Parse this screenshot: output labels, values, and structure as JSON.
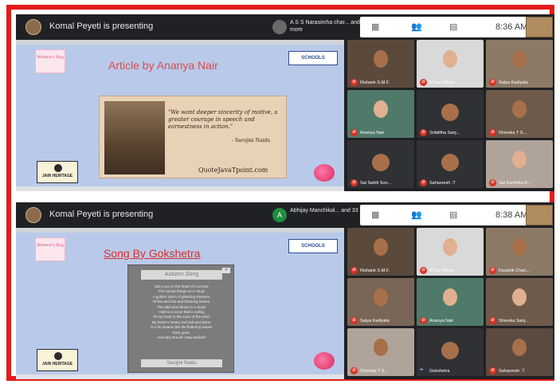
{
  "colors": {
    "frame": "#e41b1b",
    "meet_bg": "#202124",
    "slide_bg": "#b9c9ea",
    "mic_muted": "#d93025"
  },
  "top": {
    "presenter": "Komal Peyeti is presenting",
    "chat_preview": "A S S Narasimha char... and 30 more",
    "time": "8:36 AM",
    "slide": {
      "title": "Article by Ananya Nair",
      "womens_day_badge": "Women's Day",
      "school_logo": "SCHOOLS",
      "heritage_logo": "JAIN HERITAGE",
      "quote": "\"We want deeper sincerity of motive, a greater courage in speech and earnestness in action.\"",
      "quote_author": "- Sarojini Naidu",
      "quote_site": "QuoteJavaTpoint.com"
    },
    "participants": [
      {
        "name": "Rishank S.M.F.",
        "tone": "#5b4a3c",
        "face": "dark"
      },
      {
        "name": "M.Sai Nithya",
        "tone": "#d9d9d9",
        "face": "light"
      },
      {
        "name": "Satya Kadiyala",
        "tone": "#8c7a66",
        "face": "dark"
      },
      {
        "name": "Ananya Nair",
        "tone": "#4f7a6a",
        "face": "light"
      },
      {
        "name": "Srilalitha Sanj...",
        "tone": "#303134",
        "face": "round"
      },
      {
        "name": "Shreeka T S...",
        "tone": "#6e5a4a",
        "face": "dark"
      },
      {
        "name": "Sai Sahiti Son...",
        "tone": "#303134",
        "face": "round"
      },
      {
        "name": "Sahasresh .T",
        "tone": "#303134",
        "face": "round"
      },
      {
        "name": "Sai Kanthika K...",
        "tone": "#b0a49a",
        "face": "light"
      }
    ]
  },
  "bottom": {
    "presenter": "Komal Peyeti is presenting",
    "chat_initial": "A",
    "chat_preview": "Abhijay Manchikal... and 33 more",
    "time": "8:38 AM",
    "slide": {
      "title": "Song By  Gokshetra",
      "womens_day_badge": "Women's Day",
      "school_logo": "SCHOOLS",
      "heritage_logo": "JAIN HERITAGE",
      "song_heading": "Autumn Song",
      "song_close": "✕",
      "song_lines": [
        "Like a joy on the heart of a sorrow,",
        "The sunset hangs on a cloud;",
        "A golden storm of glittering sheaves,",
        "Of fair and frail and fluttering leaves,",
        "The wild wind blows in a cloud.",
        "Hark to a voice that is calling",
        "To my heart in the voice of the wind:",
        "My heart is weary and sad and alone,",
        "For its dreams like the fluttering leaves",
        "have gone,",
        "And why should I stay behind?"
      ],
      "song_author": "Sarojini Naidu"
    },
    "participants": [
      {
        "name": "Rishank S.M.F.",
        "tone": "#5b4a3c",
        "face": "dark"
      },
      {
        "name": "M.Sai Nithya",
        "tone": "#d9d9d9",
        "face": "light"
      },
      {
        "name": "Kaushik Chari...",
        "tone": "#8c7a66",
        "face": "dark"
      },
      {
        "name": "Satya Kadiyala",
        "tone": "#7a6656",
        "face": "dark"
      },
      {
        "name": "Ananya Nair",
        "tone": "#4f7a6a",
        "face": "light"
      },
      {
        "name": "Shreeka Sanj...",
        "tone": "#6e5a4a",
        "face": "light"
      },
      {
        "name": "Shreeka T S...",
        "tone": "#b0a49a",
        "face": "dark"
      },
      {
        "name": "Gokshetra",
        "tone": "#303134",
        "face": "round"
      },
      {
        "name": "Sahasresh .T",
        "tone": "#5a4a40",
        "face": "dark"
      }
    ]
  }
}
